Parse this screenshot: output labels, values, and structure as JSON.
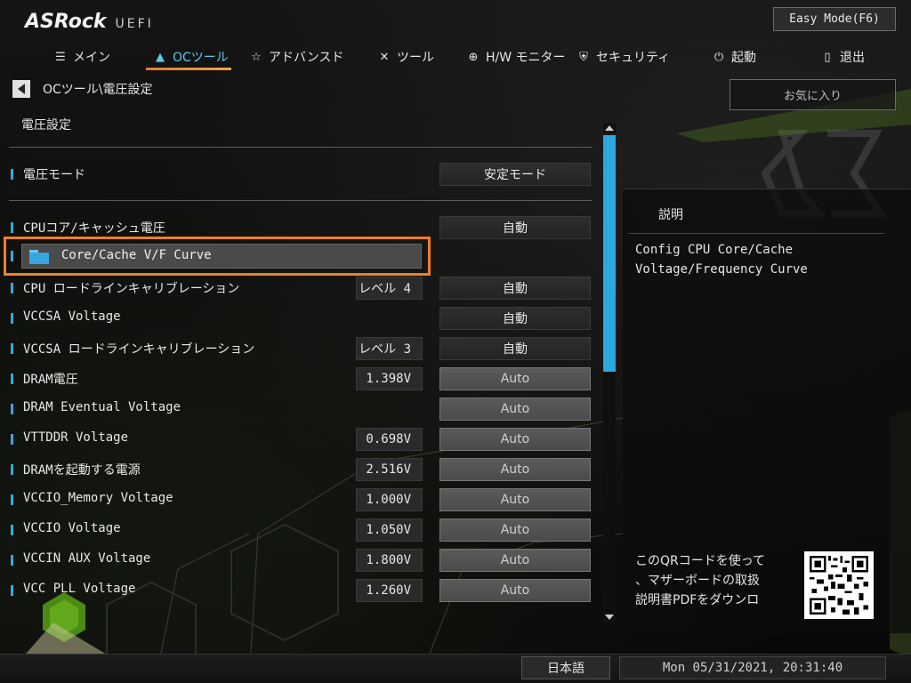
{
  "brand": {
    "name": "ASRock",
    "product": "UEFI"
  },
  "header": {
    "easy_mode_label": "Easy Mode(F6)"
  },
  "nav": {
    "items": [
      {
        "label": "メイン",
        "icon": "list-icon"
      },
      {
        "label": "OCツール",
        "icon": "rocket-icon",
        "active": true
      },
      {
        "label": "アドバンスド",
        "icon": "star-icon"
      },
      {
        "label": "ツール",
        "icon": "tools-icon"
      },
      {
        "label": "H/W モニター",
        "icon": "crosshair-icon"
      },
      {
        "label": "セキュリティ",
        "icon": "shield-icon"
      },
      {
        "label": "起動",
        "icon": "power-icon"
      },
      {
        "label": "退出",
        "icon": "exit-door-icon"
      }
    ]
  },
  "breadcrumb": {
    "path": "OCツール\\電圧設定"
  },
  "favorites_label": "お気に入り",
  "section_title": "電圧設定",
  "voltage_mode": {
    "label": "電圧モード",
    "value": "安定モード"
  },
  "settings": [
    {
      "label": "CPUコア/キャッシュ電圧",
      "value": "",
      "option": "自動",
      "dim": false
    },
    {
      "label": "CPU ロードラインキャリブレーション",
      "value": "レベル 4",
      "option": "自動",
      "dim": false
    },
    {
      "label": "VCCSA Voltage",
      "value": "",
      "option": "自動",
      "dim": false
    },
    {
      "label": "VCCSA ロードラインキャリブレーション",
      "value": "レベル 3",
      "option": "自動",
      "dim": false
    },
    {
      "label": "DRAM電圧",
      "value": "1.398V",
      "option": "Auto",
      "dim": true
    },
    {
      "label": "DRAM Eventual Voltage",
      "value": "",
      "option": "Auto",
      "dim": true
    },
    {
      "label": "VTTDDR Voltage",
      "value": "0.698V",
      "option": "Auto",
      "dim": true
    },
    {
      "label": "DRAMを起動する電源",
      "value": "2.516V",
      "option": "Auto",
      "dim": true
    },
    {
      "label": "VCCIO_Memory Voltage",
      "value": "1.000V",
      "option": "Auto",
      "dim": true
    },
    {
      "label": "VCCIO Voltage",
      "value": "1.050V",
      "option": "Auto",
      "dim": true
    },
    {
      "label": "VCCIN AUX Voltage",
      "value": "1.800V",
      "option": "Auto",
      "dim": true
    },
    {
      "label": "VCC PLL Voltage",
      "value": "1.260V",
      "option": "Auto",
      "dim": true
    }
  ],
  "submenu": {
    "label": "Core/Cache V/F Curve",
    "icon": "folder-icon"
  },
  "description": {
    "title": "説明",
    "text": "Config CPU Core/Cache\nVoltage/Frequency Curve"
  },
  "qr": {
    "text": "このQRコードを使って\n、マザーボードの取扱\n説明書PDFをダウンロ"
  },
  "footer": {
    "language": "日本語",
    "datetime": "Mon 05/31/2021, 20:31:40"
  },
  "colors": {
    "accent": "#2aa8e0",
    "highlight": "#f07f25",
    "active_nav": "#5ec8f0"
  }
}
